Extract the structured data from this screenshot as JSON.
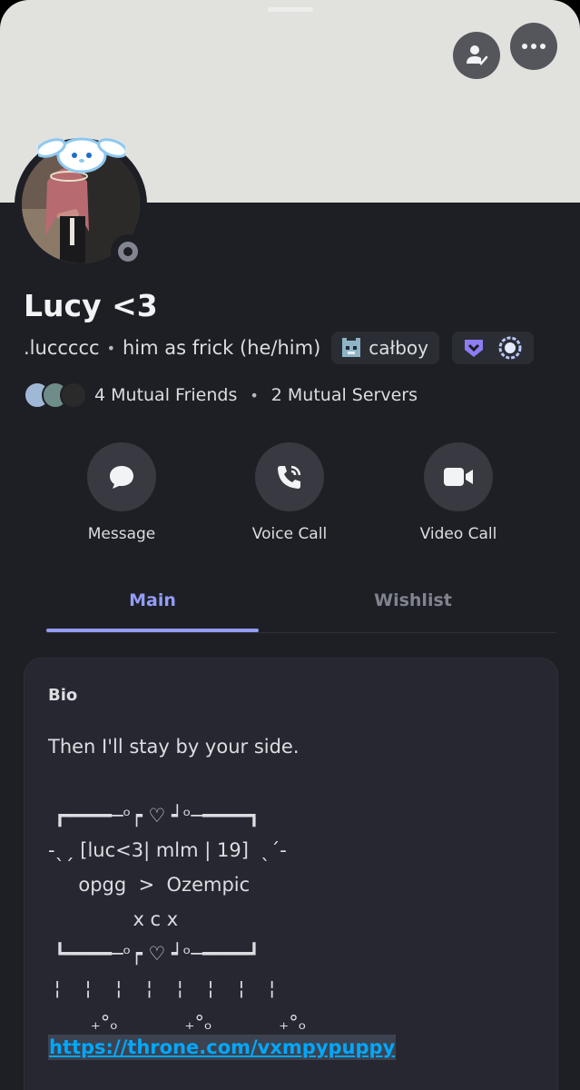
{
  "profile": {
    "display_name": "Lucy <3",
    "username": ".luccccc",
    "pronouns_status": "him as frick (he/him)",
    "tag": "całboy",
    "status": "offline"
  },
  "header_actions": {
    "friend_icon": "person-check-icon",
    "more_icon": "more-horizontal-icon"
  },
  "mutuals": {
    "friends": "4 Mutual Friends",
    "servers": "2 Mutual Servers"
  },
  "actions": [
    {
      "label": "Message",
      "icon": "chat-bubble-icon"
    },
    {
      "label": "Voice Call",
      "icon": "phone-icon"
    },
    {
      "label": "Video Call",
      "icon": "video-camera-icon"
    }
  ],
  "tabs": [
    {
      "label": "Main",
      "active": true
    },
    {
      "label": "Wishlist",
      "active": false
    }
  ],
  "bio": {
    "title": "Bio",
    "text": "Then I'll stay by your side.\n\n ┏━━━━─ᵒ┍ ♡ ┙ᵒ─━━━━┓\n-ˎˏ [luc<3| mlm | 19]  ˎˊ-\n     opgg  >  Ozempic\n              x c x\n ┗━━━━─ᵒ┍ ♡ ┙ᵒ─━━━━┛\n ¦    ¦    ¦    ¦    ¦    ¦    ¦    ¦\n       ₊°ₒ           ₊°ₒ           ₊°ₒ",
    "link": "https://throne.com/vxmpypuppy"
  },
  "colors": {
    "banner": "#e1e2de",
    "background": "#1e1f25",
    "accent": "#949cf7",
    "link": "#00a8fc"
  }
}
